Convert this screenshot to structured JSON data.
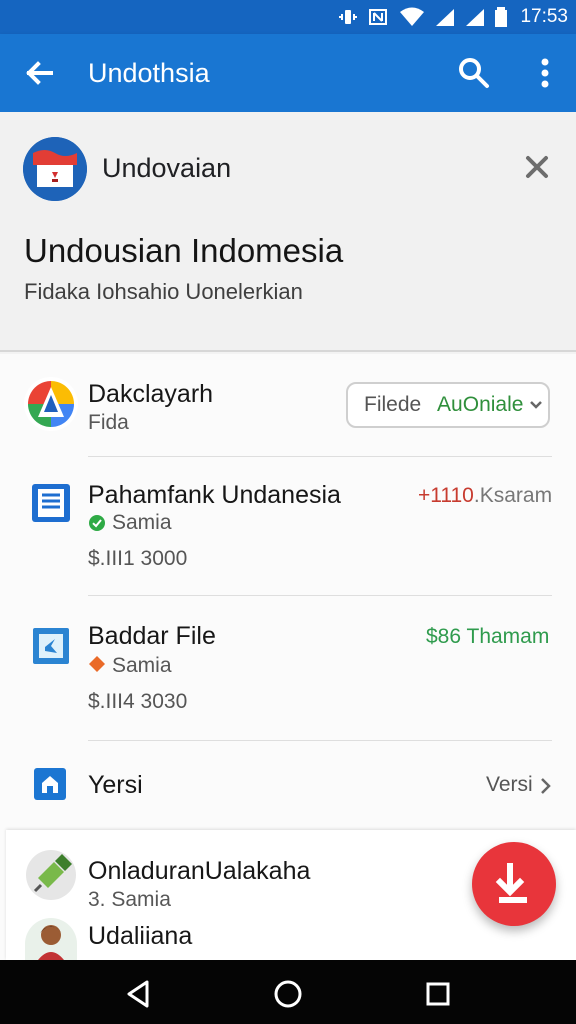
{
  "status_bar": {
    "time": "17:53",
    "icons": [
      "vibrate-icon",
      "nfc-icon",
      "wifi-icon",
      "signal-icon",
      "signal-icon",
      "battery-icon"
    ]
  },
  "app_bar": {
    "title": "Undothsia",
    "icons": [
      "back-arrow-icon",
      "search-icon",
      "more-vert-icon"
    ],
    "color": "#1976d2"
  },
  "header": {
    "avatar_name": "Undovaian",
    "title": "Undousian Indomesia",
    "subtitle": "Fidaka Iohsahio Uonelerkian",
    "icons": [
      "flag-icon",
      "close-icon"
    ]
  },
  "list": {
    "top_item": {
      "title": "Dakclayarh",
      "subtitle": "Fida",
      "select_prefix": "Filede",
      "select_value": "AuOniale",
      "icon": "colorful-triangle-icon"
    },
    "transactions": [
      {
        "title": "Pahamfank Undanesia",
        "status": "Samia",
        "amount": "$.III1 3000",
        "right_text": "+1110",
        "right_suffix": ".Ksaram",
        "icon": "document-icon",
        "status_icon": "check-circle-icon",
        "accent": "#c73b2f"
      },
      {
        "title": "Baddar File",
        "status": "Samia",
        "amount": "$.III4 3030",
        "right_text": "$86 Thamam",
        "icon": "file-icon",
        "status_icon": "warning-icon",
        "accent": "#2f9b4d"
      }
    ],
    "version_item": {
      "title": "Yersi",
      "value": "Versi",
      "icon": "home-icon"
    }
  },
  "lower_card": {
    "items": [
      {
        "title": "OnladuranUalakaha",
        "subtitle": "3. Samia",
        "icon": "plugin-icon"
      },
      {
        "title": "Udaliiana",
        "subtitle": "",
        "icon": "person-avatar-icon"
      }
    ]
  },
  "fab": {
    "icon": "download-icon",
    "color": "#e8353b"
  },
  "navigation": {
    "icons": [
      "back-icon",
      "home-icon",
      "recents-icon"
    ]
  }
}
